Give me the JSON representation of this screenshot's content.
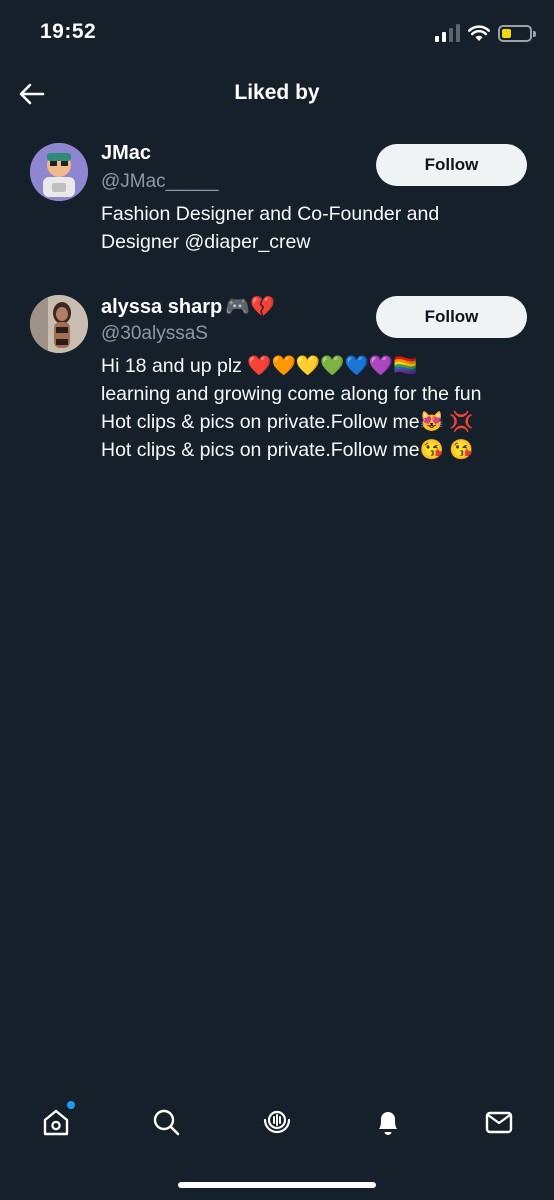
{
  "status_bar": {
    "time": "19:52"
  },
  "header": {
    "title": "Liked by"
  },
  "users": [
    {
      "name": "JMac",
      "handle": "@JMac_____",
      "bio": "Fashion Designer and Co-Founder and\nDesigner @diaper_crew",
      "follow_label": "Follow"
    },
    {
      "name": "alyssa sharp",
      "name_emojis": "🎮💔",
      "handle": "@30alyssaS",
      "bio": "Hi 18 and up plz ❤️🧡💛💚💙💜🏳️‍🌈\nlearning and growing come along for the fun\nHot clips & pics on private.Follow me😻 💢\nHot clips & pics on private.Follow me😘 😘",
      "follow_label": "Follow"
    }
  ],
  "bottom_nav": {
    "items": [
      "home-icon",
      "search-icon",
      "spaces-icon",
      "notifications-icon",
      "messages-icon"
    ],
    "accent_color": "#1d9bf0"
  },
  "colors": {
    "background": "#15202b",
    "handle_text": "#8b98a5",
    "button_bg": "#eff3f4"
  }
}
